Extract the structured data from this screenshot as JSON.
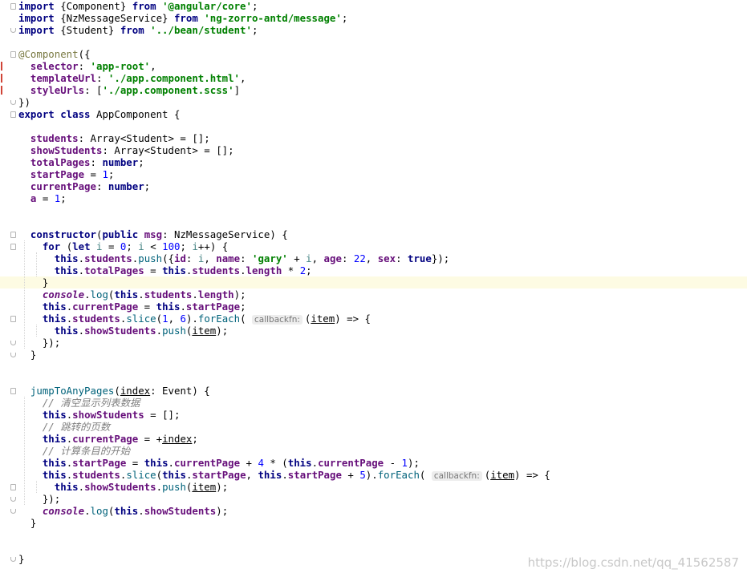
{
  "code_lines": [
    [
      {
        "t": "import",
        "c": "k"
      },
      {
        "t": " {Component} "
      },
      {
        "t": "from",
        "c": "k"
      },
      {
        "t": " "
      },
      {
        "t": "'@angular/core'",
        "c": "s"
      },
      {
        "t": ";"
      }
    ],
    [
      {
        "t": "import",
        "c": "k"
      },
      {
        "t": " {NzMessageService} "
      },
      {
        "t": "from",
        "c": "k"
      },
      {
        "t": " "
      },
      {
        "t": "'ng-zorro-antd/message'",
        "c": "s"
      },
      {
        "t": ";"
      }
    ],
    [
      {
        "t": "import",
        "c": "k"
      },
      {
        "t": " {Student} "
      },
      {
        "t": "from",
        "c": "k"
      },
      {
        "t": " "
      },
      {
        "t": "'../bean/student'",
        "c": "s"
      },
      {
        "t": ";"
      }
    ],
    [],
    [
      {
        "t": "@Component",
        "c": "m"
      },
      {
        "t": "({"
      }
    ],
    [
      {
        "t": "  "
      },
      {
        "t": "selector",
        "c": "p"
      },
      {
        "t": ": "
      },
      {
        "t": "'app-root'",
        "c": "s"
      },
      {
        "t": ","
      }
    ],
    [
      {
        "t": "  "
      },
      {
        "t": "templateUrl",
        "c": "p"
      },
      {
        "t": ": "
      },
      {
        "t": "'./app.component.html'",
        "c": "s"
      },
      {
        "t": ","
      }
    ],
    [
      {
        "t": "  "
      },
      {
        "t": "styleUrls",
        "c": "p"
      },
      {
        "t": ": ["
      },
      {
        "t": "'./app.component.scss'",
        "c": "s"
      },
      {
        "t": "]"
      }
    ],
    [
      {
        "t": "})"
      }
    ],
    [
      {
        "t": "export class",
        "c": "k"
      },
      {
        "t": " AppComponent {"
      }
    ],
    [],
    [
      {
        "t": "  "
      },
      {
        "t": "students",
        "c": "p"
      },
      {
        "t": ": Array<Student> = [];"
      }
    ],
    [
      {
        "t": "  "
      },
      {
        "t": "showStudents",
        "c": "p"
      },
      {
        "t": ": Array<Student> = [];"
      }
    ],
    [
      {
        "t": "  "
      },
      {
        "t": "totalPages",
        "c": "p"
      },
      {
        "t": ": "
      },
      {
        "t": "number",
        "c": "k"
      },
      {
        "t": ";"
      }
    ],
    [
      {
        "t": "  "
      },
      {
        "t": "startPage",
        "c": "p"
      },
      {
        "t": " = "
      },
      {
        "t": "1",
        "c": "n"
      },
      {
        "t": ";"
      }
    ],
    [
      {
        "t": "  "
      },
      {
        "t": "currentPage",
        "c": "p"
      },
      {
        "t": ": "
      },
      {
        "t": "number",
        "c": "k"
      },
      {
        "t": ";"
      }
    ],
    [
      {
        "t": "  "
      },
      {
        "t": "a",
        "c": "p"
      },
      {
        "t": " = "
      },
      {
        "t": "1",
        "c": "n"
      },
      {
        "t": ";"
      }
    ],
    [],
    [],
    [
      {
        "t": "  "
      },
      {
        "t": "constructor",
        "c": "k"
      },
      {
        "t": "("
      },
      {
        "t": "public",
        "c": "k"
      },
      {
        "t": " "
      },
      {
        "t": "msg",
        "c": "p"
      },
      {
        "t": ": NzMessageService) {"
      }
    ],
    [
      {
        "t": "    "
      },
      {
        "t": "for",
        "c": "k"
      },
      {
        "t": " ("
      },
      {
        "t": "let",
        "c": "k"
      },
      {
        "t": " "
      },
      {
        "t": "i",
        "c": "l"
      },
      {
        "t": " = "
      },
      {
        "t": "0",
        "c": "n"
      },
      {
        "t": "; "
      },
      {
        "t": "i",
        "c": "l"
      },
      {
        "t": " < "
      },
      {
        "t": "100",
        "c": "n"
      },
      {
        "t": "; "
      },
      {
        "t": "i",
        "c": "l"
      },
      {
        "t": "++) {"
      }
    ],
    [
      {
        "t": "      "
      },
      {
        "t": "this",
        "c": "k"
      },
      {
        "t": "."
      },
      {
        "t": "students",
        "c": "p"
      },
      {
        "t": "."
      },
      {
        "t": "push",
        "c": "f"
      },
      {
        "t": "({"
      },
      {
        "t": "id",
        "c": "p"
      },
      {
        "t": ": "
      },
      {
        "t": "i",
        "c": "l"
      },
      {
        "t": ", "
      },
      {
        "t": "name",
        "c": "p"
      },
      {
        "t": ": "
      },
      {
        "t": "'gary'",
        "c": "s"
      },
      {
        "t": " + "
      },
      {
        "t": "i",
        "c": "l"
      },
      {
        "t": ", "
      },
      {
        "t": "age",
        "c": "p"
      },
      {
        "t": ": "
      },
      {
        "t": "22",
        "c": "n"
      },
      {
        "t": ", "
      },
      {
        "t": "sex",
        "c": "p"
      },
      {
        "t": ": "
      },
      {
        "t": "true",
        "c": "k"
      },
      {
        "t": "});"
      }
    ],
    [
      {
        "t": "      "
      },
      {
        "t": "this",
        "c": "k"
      },
      {
        "t": "."
      },
      {
        "t": "totalPages",
        "c": "p"
      },
      {
        "t": " = "
      },
      {
        "t": "this",
        "c": "k"
      },
      {
        "t": "."
      },
      {
        "t": "students",
        "c": "p"
      },
      {
        "t": "."
      },
      {
        "t": "length",
        "c": "p"
      },
      {
        "t": " * "
      },
      {
        "t": "2",
        "c": "n"
      },
      {
        "t": ";"
      }
    ],
    [
      {
        "t": "    }"
      }
    ],
    [
      {
        "t": "    "
      },
      {
        "t": "console",
        "c": "i"
      },
      {
        "t": "."
      },
      {
        "t": "log",
        "c": "f"
      },
      {
        "t": "("
      },
      {
        "t": "this",
        "c": "k"
      },
      {
        "t": "."
      },
      {
        "t": "students",
        "c": "p"
      },
      {
        "t": "."
      },
      {
        "t": "length",
        "c": "p"
      },
      {
        "t": ");"
      }
    ],
    [
      {
        "t": "    "
      },
      {
        "t": "this",
        "c": "k"
      },
      {
        "t": "."
      },
      {
        "t": "currentPage",
        "c": "p"
      },
      {
        "t": " = "
      },
      {
        "t": "this",
        "c": "k"
      },
      {
        "t": "."
      },
      {
        "t": "startPage",
        "c": "p"
      },
      {
        "t": ";"
      }
    ],
    [
      {
        "t": "    "
      },
      {
        "t": "this",
        "c": "k"
      },
      {
        "t": "."
      },
      {
        "t": "students",
        "c": "p"
      },
      {
        "t": "."
      },
      {
        "t": "slice",
        "c": "f"
      },
      {
        "t": "("
      },
      {
        "t": "1",
        "c": "n"
      },
      {
        "t": ", "
      },
      {
        "t": "6",
        "c": "n"
      },
      {
        "t": ")."
      },
      {
        "t": "forEach",
        "c": "f"
      },
      {
        "t": "( "
      },
      {
        "t": "callbackfn:",
        "c": "h"
      },
      {
        "t": "("
      },
      {
        "t": "item",
        "c": "u"
      },
      {
        "t": ") => {"
      }
    ],
    [
      {
        "t": "      "
      },
      {
        "t": "this",
        "c": "k"
      },
      {
        "t": "."
      },
      {
        "t": "showStudents",
        "c": "p"
      },
      {
        "t": "."
      },
      {
        "t": "push",
        "c": "f"
      },
      {
        "t": "("
      },
      {
        "t": "item",
        "c": "u"
      },
      {
        "t": ");"
      }
    ],
    [
      {
        "t": "    });"
      }
    ],
    [
      {
        "t": "  }"
      }
    ],
    [],
    [],
    [
      {
        "t": "  "
      },
      {
        "t": "jumpToAnyPages",
        "c": "f"
      },
      {
        "t": "("
      },
      {
        "t": "index",
        "c": "u"
      },
      {
        "t": ": Event) {"
      }
    ],
    [
      {
        "t": "    "
      },
      {
        "t": "// 清空显示列表数据",
        "c": "c"
      }
    ],
    [
      {
        "t": "    "
      },
      {
        "t": "this",
        "c": "k"
      },
      {
        "t": "."
      },
      {
        "t": "showStudents",
        "c": "p"
      },
      {
        "t": " = [];"
      }
    ],
    [
      {
        "t": "    "
      },
      {
        "t": "// 跳转的页数",
        "c": "c"
      }
    ],
    [
      {
        "t": "    "
      },
      {
        "t": "this",
        "c": "k"
      },
      {
        "t": "."
      },
      {
        "t": "currentPage",
        "c": "p"
      },
      {
        "t": " = +"
      },
      {
        "t": "index",
        "c": "u"
      },
      {
        "t": ";"
      }
    ],
    [
      {
        "t": "    "
      },
      {
        "t": "// 计算条目的开始",
        "c": "c"
      }
    ],
    [
      {
        "t": "    "
      },
      {
        "t": "this",
        "c": "k"
      },
      {
        "t": "."
      },
      {
        "t": "startPage",
        "c": "p"
      },
      {
        "t": " = "
      },
      {
        "t": "this",
        "c": "k"
      },
      {
        "t": "."
      },
      {
        "t": "currentPage",
        "c": "p"
      },
      {
        "t": " + "
      },
      {
        "t": "4",
        "c": "n"
      },
      {
        "t": " * ("
      },
      {
        "t": "this",
        "c": "k"
      },
      {
        "t": "."
      },
      {
        "t": "currentPage",
        "c": "p"
      },
      {
        "t": " - "
      },
      {
        "t": "1",
        "c": "n"
      },
      {
        "t": ");"
      }
    ],
    [
      {
        "t": "    "
      },
      {
        "t": "this",
        "c": "k"
      },
      {
        "t": "."
      },
      {
        "t": "students",
        "c": "p"
      },
      {
        "t": "."
      },
      {
        "t": "slice",
        "c": "f"
      },
      {
        "t": "("
      },
      {
        "t": "this",
        "c": "k"
      },
      {
        "t": "."
      },
      {
        "t": "startPage",
        "c": "p"
      },
      {
        "t": ", "
      },
      {
        "t": "this",
        "c": "k"
      },
      {
        "t": "."
      },
      {
        "t": "startPage",
        "c": "p"
      },
      {
        "t": " + "
      },
      {
        "t": "5",
        "c": "n"
      },
      {
        "t": ")."
      },
      {
        "t": "forEach",
        "c": "f"
      },
      {
        "t": "( "
      },
      {
        "t": "callbackfn:",
        "c": "h"
      },
      {
        "t": "("
      },
      {
        "t": "item",
        "c": "u"
      },
      {
        "t": ") => {"
      }
    ],
    [
      {
        "t": "      "
      },
      {
        "t": "this",
        "c": "k"
      },
      {
        "t": "."
      },
      {
        "t": "showStudents",
        "c": "p"
      },
      {
        "t": "."
      },
      {
        "t": "push",
        "c": "f"
      },
      {
        "t": "("
      },
      {
        "t": "item",
        "c": "u"
      },
      {
        "t": ");"
      }
    ],
    [
      {
        "t": "    });"
      }
    ],
    [
      {
        "t": "    "
      },
      {
        "t": "console",
        "c": "i"
      },
      {
        "t": "."
      },
      {
        "t": "log",
        "c": "f"
      },
      {
        "t": "("
      },
      {
        "t": "this",
        "c": "k"
      },
      {
        "t": "."
      },
      {
        "t": "showStudents",
        "c": "p"
      },
      {
        "t": ");"
      }
    ],
    [
      {
        "t": "  }"
      }
    ],
    [],
    [],
    [
      {
        "t": "}"
      }
    ]
  ],
  "highlighted_line": 23,
  "watermark": "https://blog.csdn.net/qq_41562587",
  "colors": {
    "keyword": "#000080",
    "string": "#008000",
    "number": "#0000ff",
    "property": "#660e7a",
    "function": "#00627a",
    "decorator": "#7a7a43",
    "comment": "#808080",
    "current_line": "#fdfbe3"
  }
}
